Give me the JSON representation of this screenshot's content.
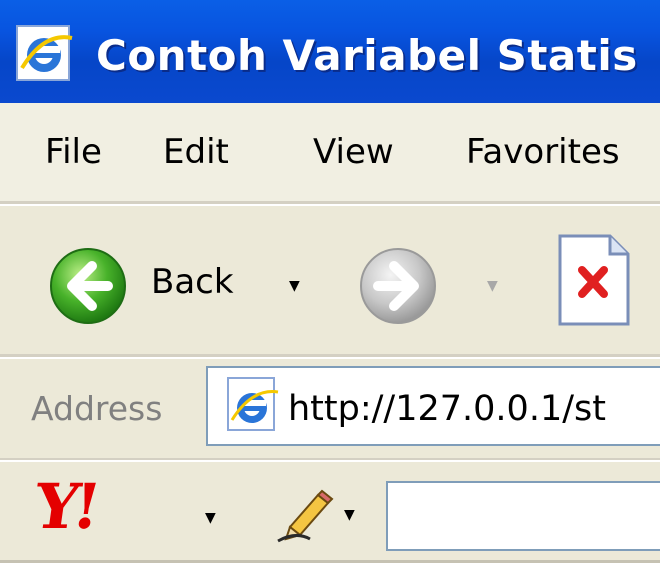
{
  "window": {
    "title": "Contoh Variabel Statis"
  },
  "menu": {
    "items": [
      "File",
      "Edit",
      "View",
      "Favorites"
    ]
  },
  "toolbar": {
    "back_label": "Back"
  },
  "address": {
    "label": "Address",
    "url": "http://127.0.0.1/st"
  },
  "yahoo": {
    "logo_text": "Y!"
  },
  "colors": {
    "titlebar": "#0a5fe6",
    "yahoo_red": "#e40000",
    "back_green": "#2f9a1f"
  },
  "icons": {
    "title": "ie-icon",
    "back": "back-arrow-icon",
    "forward": "forward-arrow-icon",
    "stop": "stop-icon",
    "address": "ie-page-icon",
    "highlight": "pencil-icon"
  }
}
